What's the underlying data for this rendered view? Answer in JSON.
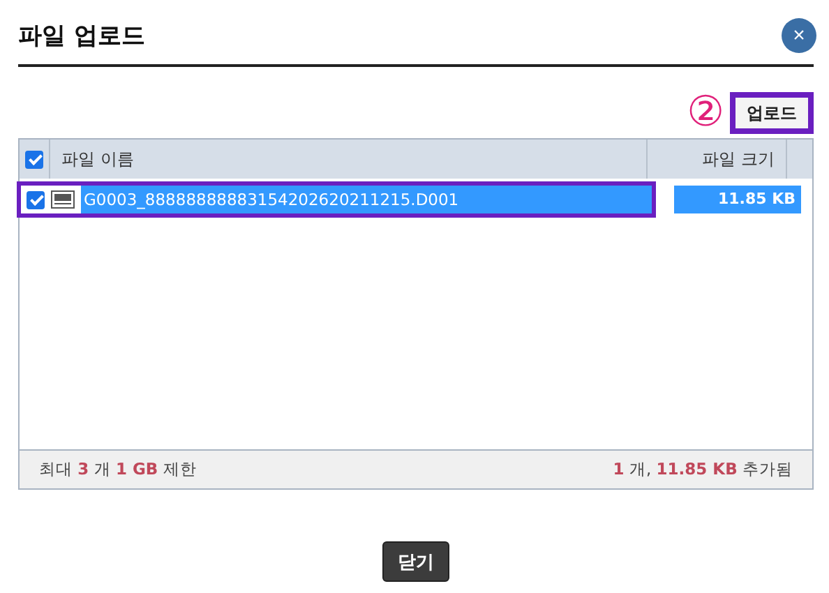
{
  "dialog": {
    "title": "파일 업로드",
    "close_icon": "×"
  },
  "upload": {
    "step": "②",
    "label": "업로드",
    "highlighted": true
  },
  "table": {
    "select_all": {
      "checked": true
    },
    "columns": [
      "파일 이름",
      "파일 크기"
    ],
    "rows": [
      {
        "checked": true,
        "selected": true,
        "highlighted": true,
        "name": "G0003_88888888883154202620211215.D001",
        "size": "11.85 KB"
      }
    ]
  },
  "footer": {
    "limit": "최대 **3** 개 **1 GB** 제한",
    "added": "**1** 개, **11.85 KB** 추가됨"
  },
  "buttons": [
    "닫기"
  ]
}
